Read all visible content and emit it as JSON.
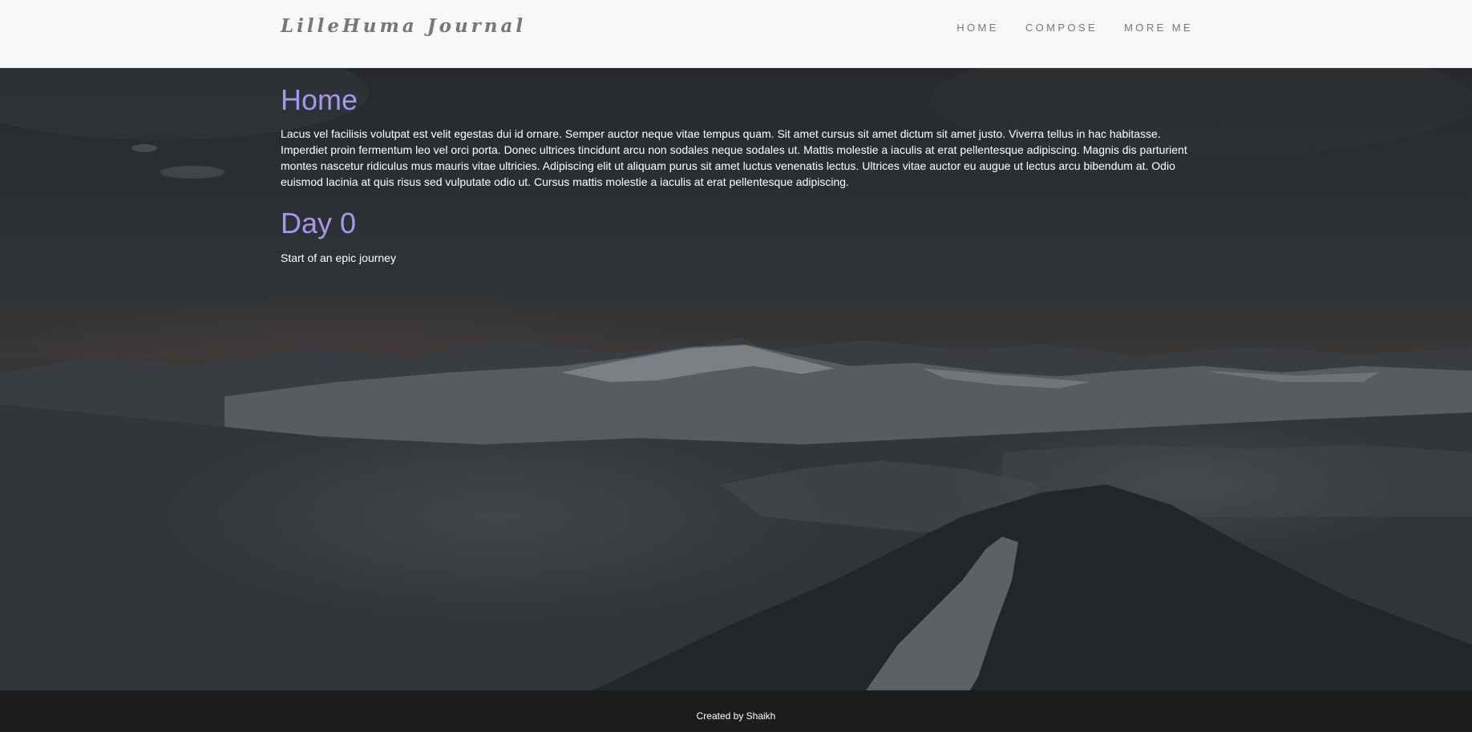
{
  "header": {
    "brand": "LilleHuma Journal",
    "nav": [
      "HOME",
      "COMPOSE",
      "MORE ME"
    ]
  },
  "home": {
    "title": "Home",
    "body": "Lacus vel facilisis volutpat est velit egestas dui id ornare. Semper auctor neque vitae tempus quam. Sit amet cursus sit amet dictum sit amet justo. Viverra tellus in hac habitasse. Imperdiet proin fermentum leo vel orci porta. Donec ultrices tincidunt arcu non sodales neque sodales ut. Mattis molestie a iaculis at erat pellentesque adipiscing. Magnis dis parturient montes nascetur ridiculus mus mauris vitae ultricies. Adipiscing elit ut aliquam purus sit amet luctus venenatis lectus. Ultrices vitae auctor eu augue ut lectus arcu bibendum at. Odio euismod lacinia at quis risus sed vulputate odio ut. Cursus mattis molestie a iaculis at erat pellentesque adipiscing."
  },
  "posts": [
    {
      "title": "Day 0",
      "body": "Start of an epic journey"
    }
  ],
  "footer": {
    "text": "Created by Shaikh"
  },
  "colors": {
    "heading": "#a796ec",
    "navbar_bg": "#f8f8f8",
    "nav_text": "#777777",
    "footer_bg": "#1a1c1d"
  }
}
